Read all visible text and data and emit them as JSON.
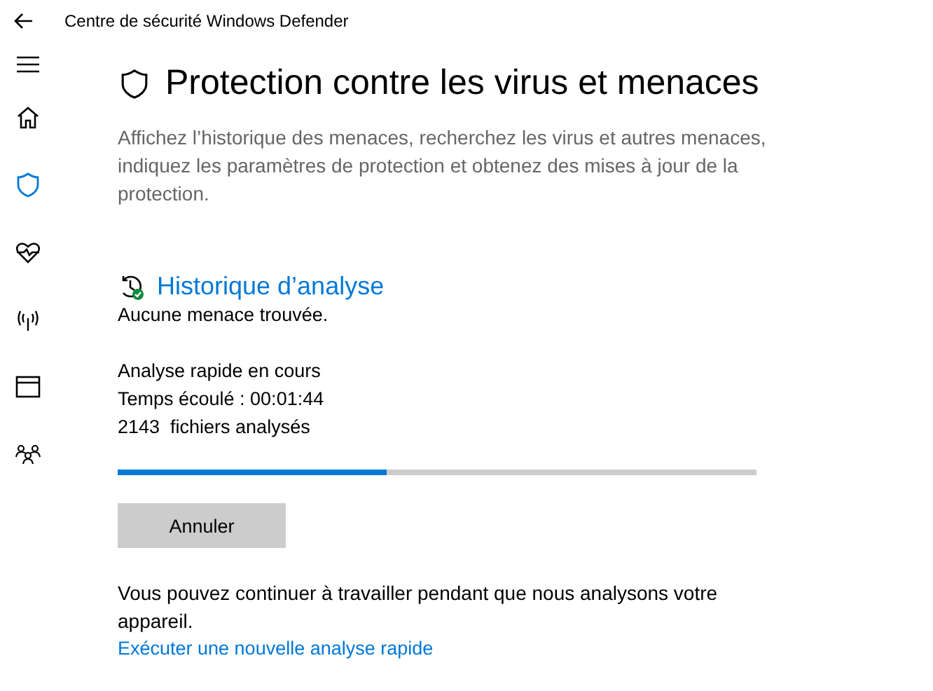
{
  "window": {
    "title": "Centre de sécurité Windows Defender"
  },
  "sidebar": {
    "items": [
      {
        "kind": "home",
        "selected": false
      },
      {
        "kind": "shield",
        "selected": true
      },
      {
        "kind": "health",
        "selected": false
      },
      {
        "kind": "network",
        "selected": false
      },
      {
        "kind": "browser",
        "selected": false
      },
      {
        "kind": "family",
        "selected": false
      }
    ]
  },
  "page": {
    "title": "Protection contre les virus et menaces",
    "description": "Affichez l’historique des menaces, recherchez les virus et autres menaces, indiquez les paramètres de protection et obtenez des mises à jour de la protection."
  },
  "scan": {
    "heading": "Historique d’analyse",
    "status": "Aucune menace trouvée.",
    "lines": [
      "Analyse rapide en cours",
      "Temps écoulé : 00:01:44",
      "2143  fichiers analysés"
    ],
    "progress": {
      "level": 0.42
    },
    "cancel_button": "Annuler",
    "note": "Vous pouvez continuer à travailler pendant que nous analysons votre appareil.",
    "link": "Exécuter une nouvelle analyse rapide"
  }
}
